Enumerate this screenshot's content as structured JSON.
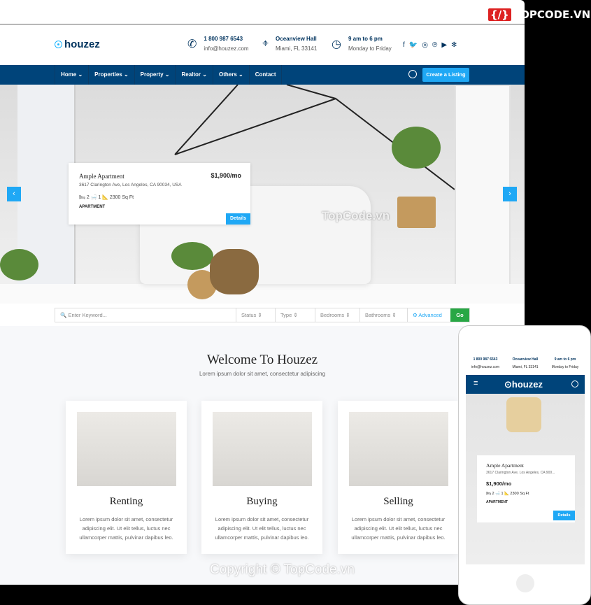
{
  "watermark": "TOPCODE.VN",
  "logo": "houzez",
  "contact": [
    {
      "title": "1 800 987 6543",
      "sub": "info@houzez.com",
      "icon": "phone-icon"
    },
    {
      "title": "Oceanview Hall",
      "sub": "Miami, FL 33141",
      "icon": "location-pin-icon"
    },
    {
      "title": "9 am to 6 pm",
      "sub": "Monday to Friday",
      "icon": "clock-icon"
    }
  ],
  "social": [
    "f",
    "t",
    "ig",
    "p",
    "yt",
    "y"
  ],
  "nav": {
    "items": [
      "Home ⌄",
      "Properties ⌄",
      "Property ⌄",
      "Realtor ⌄",
      "Others ⌄",
      "Contact"
    ],
    "cta": "Create a Listing"
  },
  "listing": {
    "title": "Ample Apartment",
    "price": "$1,900/mo",
    "address": "3617 Clarington Ave, Los Angeles, CA 90034, USA",
    "address_short": "3617 Clarington Ave, Los Angeles, CA 900...",
    "features": "🛏 2   🛁 1   📐 2300 Sq Ft",
    "type": "APARTMENT",
    "details": "Details"
  },
  "hero_watermark": "TopCode.vn",
  "search": {
    "placeholder": "Enter Keyword...",
    "status": "Status ⇕",
    "type": "Type ⇕",
    "bedrooms": "Bedrooms ⇕",
    "bathrooms": "Bathrooms ⇕",
    "advanced": "⚙ Advanced",
    "go": "Go"
  },
  "welcome": {
    "title": "Welcome To Houzez",
    "subtitle": "Lorem ipsum dolor sit amet, consectetur adipiscing"
  },
  "features": [
    {
      "title": "Renting",
      "text": "Lorem ipsum dolor sit amet, consectetur adipiscing elit. Ut elit tellus, luctus nec ullamcorper mattis, pulvinar dapibus leo."
    },
    {
      "title": "Buying",
      "text": "Lorem ipsum dolor sit amet, consectetur adipiscing elit. Ut elit tellus, luctus nec ullamcorper mattis, pulvinar dapibus leo."
    },
    {
      "title": "Selling",
      "text": "Lorem ipsum dolor sit amet, consectetur adipiscing elit. Ut elit tellus, luctus nec ullamcorper mattis, pulvinar dapibus leo."
    }
  ],
  "copyright": "Copyright © TopCode.vn",
  "colors": {
    "nav": "#00447a",
    "accent": "#1fa8f5",
    "go": "#28a745"
  }
}
